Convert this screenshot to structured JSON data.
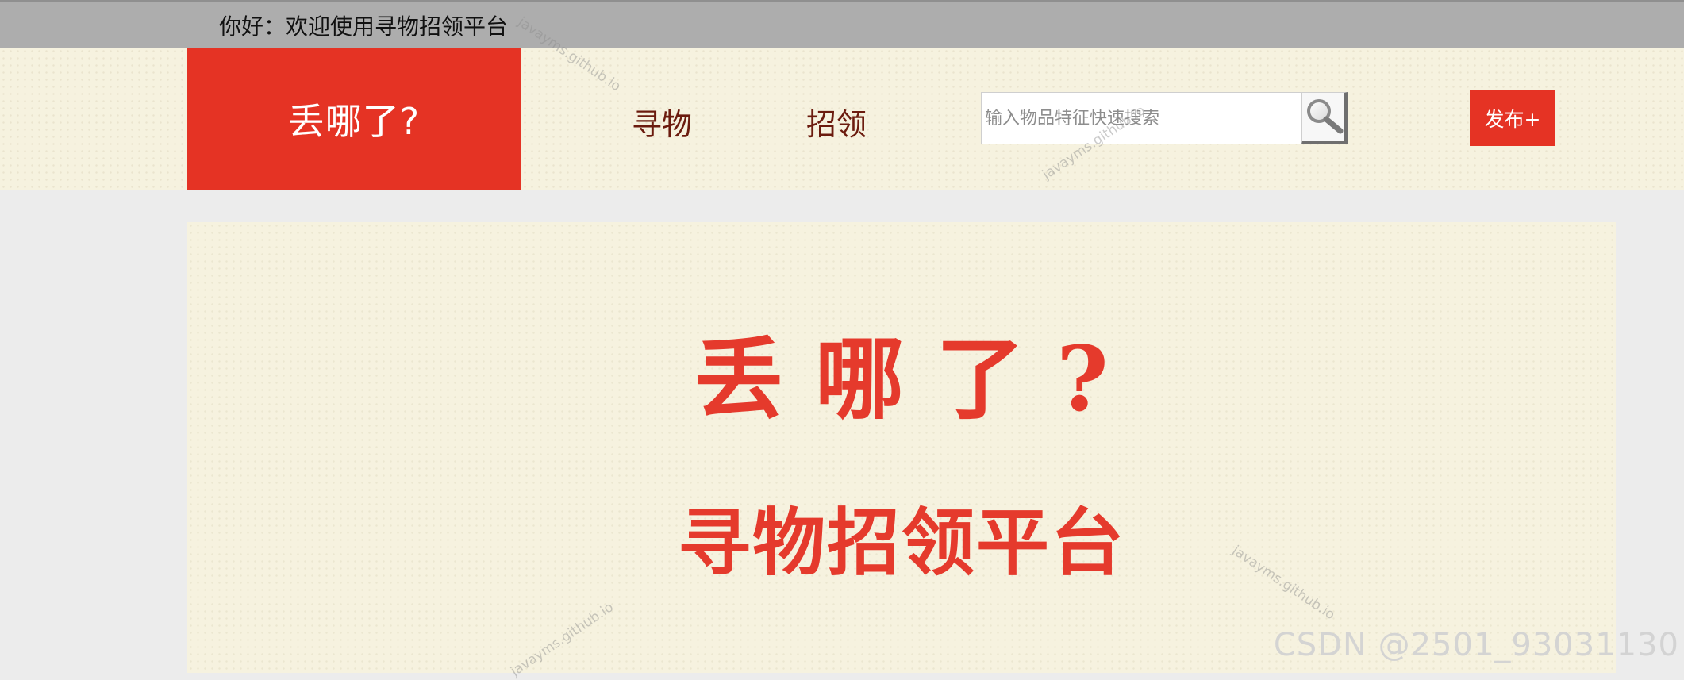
{
  "topbar": {
    "greeting": "你好：欢迎使用寻物招领平台"
  },
  "header": {
    "logo": "丢哪了?",
    "nav": {
      "find": "寻物",
      "claim": "招领"
    },
    "search": {
      "placeholder": "输入物品特征快速搜索",
      "icon": "search-icon"
    },
    "publish_button": "发布+"
  },
  "banner": {
    "title": "丢哪了?",
    "subtitle": "寻物招领平台"
  },
  "watermarks": {
    "site": "javayms.github.io",
    "csdn": "CSDN @2501_93031130"
  },
  "colors": {
    "brand_red": "#e53324",
    "cream": "#f6f2df",
    "topbar_gray": "#adadad",
    "nav_text": "#6b1b0e"
  }
}
